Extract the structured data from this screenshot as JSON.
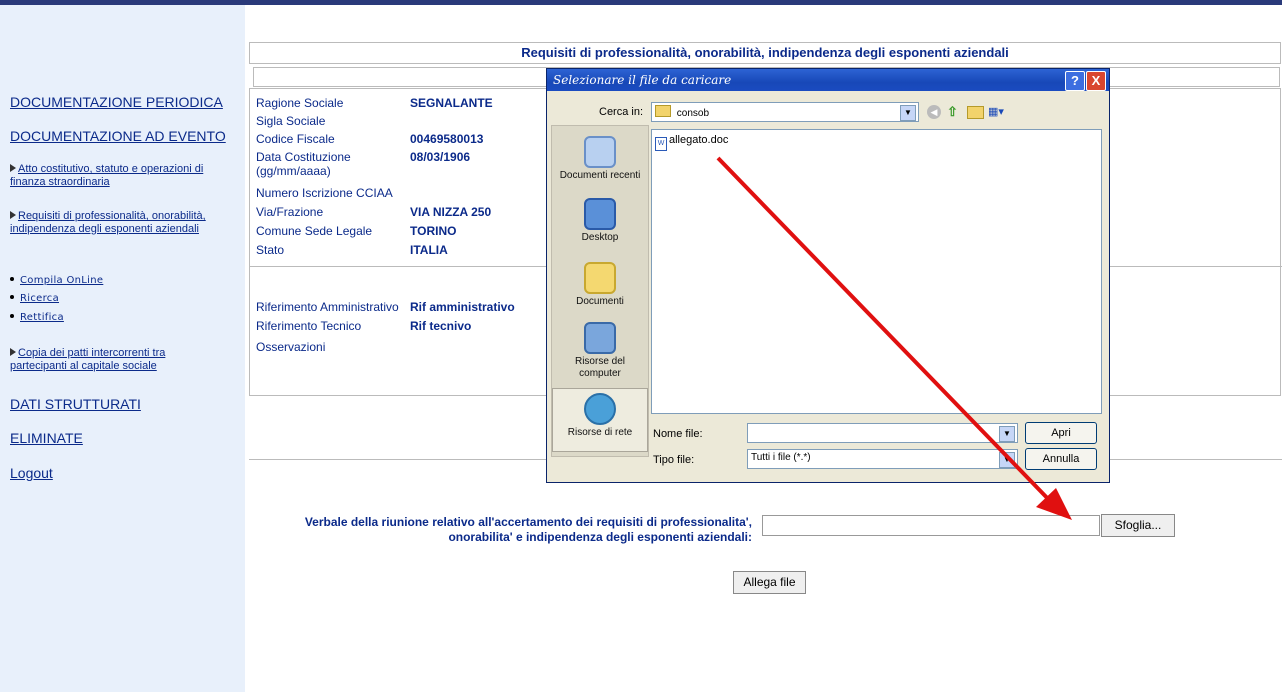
{
  "sidebar": {
    "periodica": "DOCUMENTAZIONE PERIODICA",
    "ad_evento": "DOCUMENTAZIONE AD EVENTO",
    "atto": "Atto costitutivo, statuto e operazioni di finanza straordinaria",
    "requisiti": "Requisiti di professionalità, onorabilità, indipendenza degli esponenti aziendali",
    "sub_items": [
      "Compila OnLine",
      "Ricerca",
      "Rettifica"
    ],
    "copia": "Copia dei patti intercorrenti tra partecipanti al capitale sociale",
    "dati": "DATI STRUTTURATI",
    "eliminate": "ELIMINATE",
    "logout": "Logout"
  },
  "main": {
    "title": "Requisiti di professionalità, onorabilità, indipendenza degli esponenti aziendali",
    "fields": [
      {
        "label": "Ragione Sociale",
        "value": "SEGNALANTE"
      },
      {
        "label": "Sigla Sociale",
        "value": ""
      },
      {
        "label": "Codice Fiscale",
        "value": "00469580013"
      },
      {
        "label": "Data Costituzione (gg/mm/aaaa)",
        "value": "08/03/1906"
      },
      {
        "label": "Numero Iscrizione CCIAA",
        "value": ""
      },
      {
        "label": "Via/Frazione",
        "value": "VIA NIZZA 250"
      },
      {
        "label": "Comune Sede Legale",
        "value": "TORINO"
      },
      {
        "label": "Stato",
        "value": "ITALIA"
      }
    ],
    "fields2": [
      {
        "label": "Riferimento Amministrativo",
        "value": "Rif amministrativo"
      },
      {
        "label": "Riferimento Tecnico",
        "value": "Rif tecnivo"
      },
      {
        "label": "Osservazioni",
        "value": ""
      }
    ],
    "upload_label_1": "Verbale della riunione relativo all'accertamento dei requisiti di professionalita',",
    "upload_label_2": "onorabilita' e indipendenza degli esponenti aziendali:",
    "browse_button": "Sfoglia...",
    "attach_button": "Allega file"
  },
  "dialog": {
    "title": "Selezionare il file da caricare",
    "help": "?",
    "close": "X",
    "look_in_label": "Cerca in:",
    "look_in_value": "consob",
    "places": [
      "Documenti recenti",
      "Desktop",
      "Documenti",
      "Risorse del computer",
      "Risorse di rete"
    ],
    "files": [
      "allegato.doc"
    ],
    "filename_label": "Nome file:",
    "filename_value": "",
    "filetype_label": "Tipo file:",
    "filetype_value": "Tutti i file (*.*)",
    "open_button": "Apri",
    "cancel_button": "Annulla"
  },
  "colors": {
    "link": "#0b2a8a",
    "sidebar_bg": "#e8f0fb",
    "dialog_title": "#1848b8",
    "arrow": "#e01010"
  }
}
